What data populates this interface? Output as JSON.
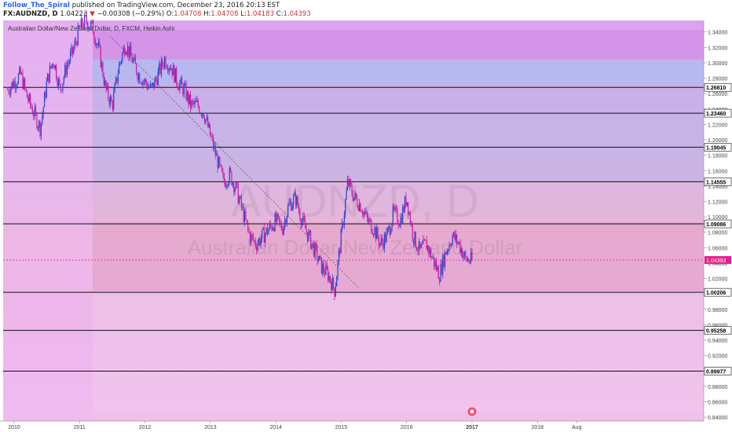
{
  "header": {
    "username": "Follow_The_Spiral",
    "published": "published on TradingView.com, December 23, 2016 20:13 EST",
    "symbol": "FX:AUDNZD, D",
    "last": "1.04223",
    "arrow": "▼",
    "change": "−0.00308 (−0.29%)",
    "o_label": "O:",
    "o_value": "1.04708",
    "h_label": "H:",
    "h_value": "1.04708",
    "l_label": "L:",
    "l_value": "1.04183",
    "c_label": "C:",
    "c_value": "1.04393"
  },
  "chart_data": {
    "type": "line",
    "title": "Australian Dollar/New Zealand Dollar, D, FXCM, Heikin Ashi",
    "watermark_symbol": "AUDNZD, D",
    "watermark_name": "Australian Dollar/New Zealand Dollar",
    "ylim": [
      0.835,
      1.355
    ],
    "y_ticks": [
      "0.84000",
      "0.86000",
      "0.88000",
      "0.90000",
      "0.92000",
      "0.94000",
      "0.96000",
      "0.98000",
      "1.00000",
      "1.02000",
      "1.04000",
      "1.06000",
      "1.08000",
      "1.10000",
      "1.12000",
      "1.14000",
      "1.16000",
      "1.18000",
      "1.20000",
      "1.22000",
      "1.24000",
      "1.26000",
      "1.28000",
      "1.30000",
      "1.32000",
      "1.34000"
    ],
    "x_ticks": [
      "2010",
      "2011",
      "2012",
      "2013",
      "2014",
      "2015",
      "2016",
      "2017",
      "2018",
      "Aug"
    ],
    "horizontal_levels": [
      "1.26810",
      "1.23460",
      "1.19045",
      "1.14555",
      "1.09086",
      "1.00206",
      "0.95258",
      "0.89977"
    ],
    "current_price": "1.04393",
    "series": [
      {
        "x": [
          2009.9,
          2010.0,
          2010.1,
          2010.2,
          2010.3,
          2010.4,
          2010.5,
          2010.6,
          2010.7,
          2010.8,
          2010.9,
          2011.0,
          2011.1,
          2011.2,
          2011.3,
          2011.4,
          2011.5,
          2011.6,
          2011.7,
          2011.8,
          2011.9,
          2012.0,
          2012.1,
          2012.2,
          2012.3,
          2012.4,
          2012.5,
          2012.6,
          2012.7,
          2012.8,
          2012.9,
          2013.0,
          2013.1,
          2013.2,
          2013.3,
          2013.4,
          2013.5,
          2013.6,
          2013.7,
          2013.8,
          2013.9,
          2014.0,
          2014.1,
          2014.2,
          2014.3,
          2014.4,
          2014.5,
          2014.6,
          2014.7,
          2014.8,
          2014.9,
          2015.0,
          2015.1,
          2015.2,
          2015.3,
          2015.4,
          2015.5,
          2015.6,
          2015.7,
          2015.8,
          2015.9,
          2016.0,
          2016.1,
          2016.2,
          2016.3,
          2016.4,
          2016.5,
          2016.6,
          2016.7,
          2016.8,
          2016.9,
          2017.0
        ],
        "values": [
          1.265,
          1.275,
          1.285,
          1.255,
          1.235,
          1.215,
          1.275,
          1.305,
          1.265,
          1.295,
          1.315,
          1.345,
          1.355,
          1.345,
          1.315,
          1.265,
          1.245,
          1.295,
          1.325,
          1.305,
          1.285,
          1.275,
          1.265,
          1.285,
          1.305,
          1.295,
          1.275,
          1.265,
          1.245,
          1.245,
          1.235,
          1.205,
          1.175,
          1.145,
          1.155,
          1.135,
          1.105,
          1.075,
          1.065,
          1.075,
          1.085,
          1.095,
          1.085,
          1.115,
          1.125,
          1.095,
          1.075,
          1.055,
          1.035,
          1.025,
          1.005,
          1.075,
          1.145,
          1.125,
          1.115,
          1.095,
          1.085,
          1.065,
          1.075,
          1.105,
          1.095,
          1.125,
          1.075,
          1.055,
          1.065,
          1.045,
          1.025,
          1.055,
          1.075,
          1.065,
          1.045,
          1.043
        ]
      }
    ],
    "colors": {
      "bull": "#2a44cc",
      "bear": "#d01aa0",
      "current": "#e91e8c"
    }
  }
}
